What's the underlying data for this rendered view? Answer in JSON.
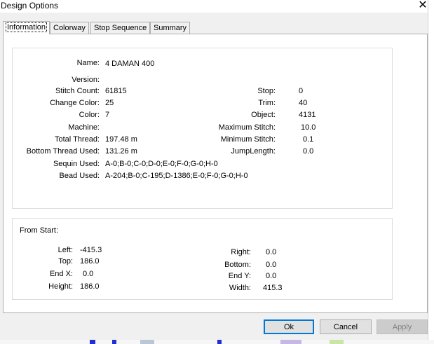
{
  "window": {
    "title": "Design Options",
    "close_glyph": "✕"
  },
  "tabs": [
    {
      "label": "Information",
      "active": true
    },
    {
      "label": "Colorway"
    },
    {
      "label": "Stop Sequence"
    },
    {
      "label": "Summary"
    }
  ],
  "info": {
    "name_label": "Name:",
    "name_value": "4 DAMAN 400",
    "version_label": "Version:",
    "version_value": "",
    "stitch_count_label": "Stitch Count:",
    "stitch_count_value": "61815",
    "change_color_label": "Change Color:",
    "change_color_value": "25",
    "color_label": "Color:",
    "color_value": "7",
    "machine_label": "Machine:",
    "machine_value": "",
    "total_thread_label": "Total Thread:",
    "total_thread_value": "197.48 m",
    "bottom_thread_label": "Bottom Thread Used:",
    "bottom_thread_value": "131.26 m",
    "sequin_label": "Sequin Used:",
    "sequin_value": "A-0;B-0;C-0;D-0;E-0;F-0;G-0;H-0",
    "bead_label": "Bead Used:",
    "bead_value": "A-204;B-0;C-195;D-1386;E-0;F-0;G-0;H-0",
    "stop_label": "Stop:",
    "stop_value": "0",
    "trim_label": "Trim:",
    "trim_value": "40",
    "object_label": "Object:",
    "object_value": "4131",
    "max_stitch_label": "Maximum Stitch:",
    "max_stitch_value": "10.0",
    "min_stitch_label": "Minimum Stitch:",
    "min_stitch_value": "0.1",
    "jump_length_label": "JumpLength:",
    "jump_length_value": "0.0"
  },
  "from_start": {
    "title": "From Start:",
    "left_label": "Left:",
    "left_value": "-415.3",
    "top_label": "Top:",
    "top_value": "186.0",
    "endx_label": "End X:",
    "endx_value": "0.0",
    "height_label": "Height:",
    "height_value": "186.0",
    "right_label": "Right:",
    "right_value": "0.0",
    "bottom_label": "Bottom:",
    "bottom_value": "0.0",
    "endy_label": "End Y:",
    "endy_value": "0.0",
    "width_label": "Width:",
    "width_value": "415.3"
  },
  "buttons": {
    "ok": "Ok",
    "cancel": "Cancel",
    "apply": "Apply"
  },
  "colors": {
    "focus_blue": "#0078d7",
    "disabled_text": "#838383"
  }
}
